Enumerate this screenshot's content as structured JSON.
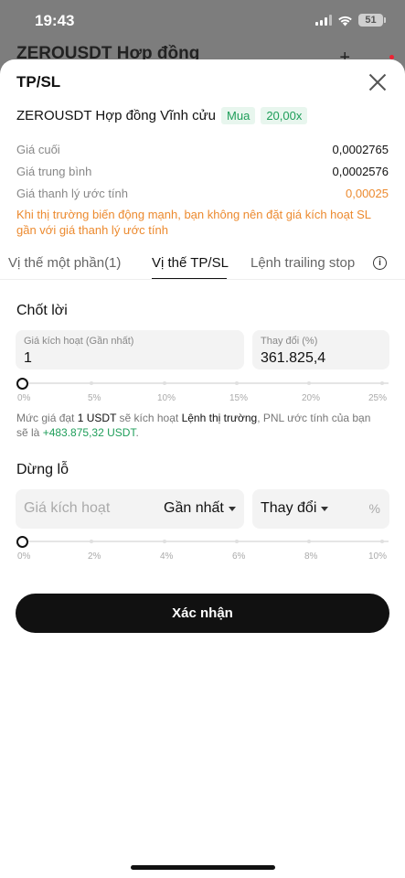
{
  "status_bar": {
    "time": "19:43",
    "battery": "51"
  },
  "background": {
    "title": "ZEROUSDT Hợp đồng",
    "plus": "+"
  },
  "sheet": {
    "title": "TP/SL",
    "contract": {
      "name": "ZEROUSDT Hợp đồng Vĩnh cửu",
      "side": "Mua",
      "leverage": "20,00x"
    },
    "info": [
      {
        "label": "Giá cuối",
        "value": "0,0002765"
      },
      {
        "label": "Giá trung bình",
        "value": "0,0002576"
      },
      {
        "label": "Giá thanh lý ước tính",
        "value": "0,00025"
      }
    ],
    "warning": "Khi thị trường biến động mạnh, bạn không nên đặt giá kích hoạt SL gần với giá thanh lý ước tính",
    "tabs": [
      "Vị thế một phần(1)",
      "Vị thế TP/SL",
      "Lệnh trailing stop"
    ],
    "active_tab": "Vị thế TP/SL",
    "take_profit": {
      "title": "Chốt lời",
      "trigger_label": "Giá kích hoạt (Gần nhất)",
      "trigger_value": "1",
      "change_label": "Thay đổi (%)",
      "change_value": "361.825,4",
      "slider_labels": [
        "0%",
        "5%",
        "10%",
        "15%",
        "20%",
        "25%"
      ],
      "slider_value_percent": 0,
      "note": {
        "part1": "Mức giá đạt ",
        "amount": "1 USDT",
        "part2": " sẽ kích hoạt ",
        "order_type": "Lệnh thị trường",
        "part3": ", PNL ước tính của bạn sẽ là ",
        "pnl": "+483.875,32 USDT",
        "part4": "."
      }
    },
    "stop_loss": {
      "title": "Dừng lỗ",
      "trigger_placeholder": "Giá kích hoạt",
      "trigger_type": "Gần nhất",
      "change_type": "Thay đổi",
      "unit": "%",
      "slider_labels": [
        "0%",
        "2%",
        "4%",
        "6%",
        "8%",
        "10%"
      ],
      "slider_value_percent": 0
    },
    "confirm_label": "Xác nhận"
  },
  "colors": {
    "accent_green": "#1f9e5a",
    "warning_orange": "#ec8a2f",
    "button_dark": "#111111"
  }
}
